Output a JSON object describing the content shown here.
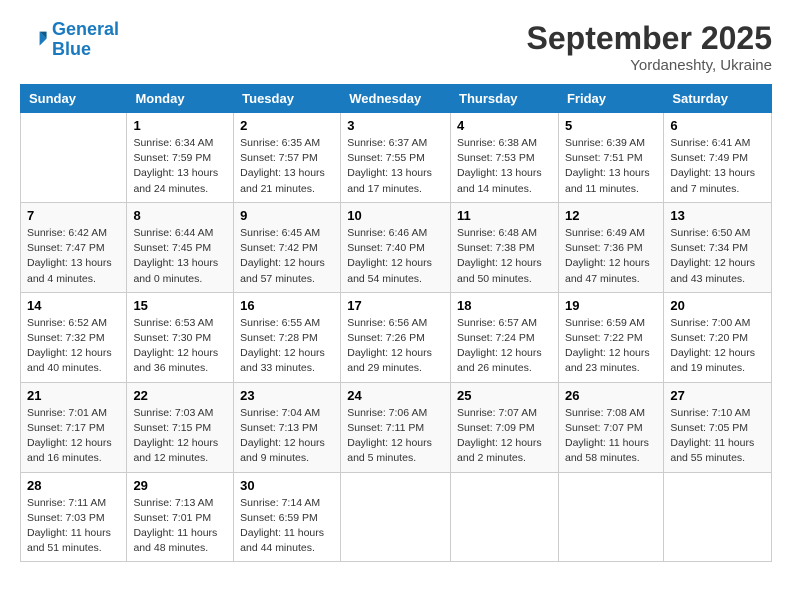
{
  "header": {
    "logo_line1": "General",
    "logo_line2": "Blue",
    "month": "September 2025",
    "location": "Yordaneshty, Ukraine"
  },
  "weekdays": [
    "Sunday",
    "Monday",
    "Tuesday",
    "Wednesday",
    "Thursday",
    "Friday",
    "Saturday"
  ],
  "weeks": [
    [
      {
        "day": "",
        "sunrise": "",
        "sunset": "",
        "daylight": ""
      },
      {
        "day": "1",
        "sunrise": "Sunrise: 6:34 AM",
        "sunset": "Sunset: 7:59 PM",
        "daylight": "Daylight: 13 hours and 24 minutes."
      },
      {
        "day": "2",
        "sunrise": "Sunrise: 6:35 AM",
        "sunset": "Sunset: 7:57 PM",
        "daylight": "Daylight: 13 hours and 21 minutes."
      },
      {
        "day": "3",
        "sunrise": "Sunrise: 6:37 AM",
        "sunset": "Sunset: 7:55 PM",
        "daylight": "Daylight: 13 hours and 17 minutes."
      },
      {
        "day": "4",
        "sunrise": "Sunrise: 6:38 AM",
        "sunset": "Sunset: 7:53 PM",
        "daylight": "Daylight: 13 hours and 14 minutes."
      },
      {
        "day": "5",
        "sunrise": "Sunrise: 6:39 AM",
        "sunset": "Sunset: 7:51 PM",
        "daylight": "Daylight: 13 hours and 11 minutes."
      },
      {
        "day": "6",
        "sunrise": "Sunrise: 6:41 AM",
        "sunset": "Sunset: 7:49 PM",
        "daylight": "Daylight: 13 hours and 7 minutes."
      }
    ],
    [
      {
        "day": "7",
        "sunrise": "Sunrise: 6:42 AM",
        "sunset": "Sunset: 7:47 PM",
        "daylight": "Daylight: 13 hours and 4 minutes."
      },
      {
        "day": "8",
        "sunrise": "Sunrise: 6:44 AM",
        "sunset": "Sunset: 7:45 PM",
        "daylight": "Daylight: 13 hours and 0 minutes."
      },
      {
        "day": "9",
        "sunrise": "Sunrise: 6:45 AM",
        "sunset": "Sunset: 7:42 PM",
        "daylight": "Daylight: 12 hours and 57 minutes."
      },
      {
        "day": "10",
        "sunrise": "Sunrise: 6:46 AM",
        "sunset": "Sunset: 7:40 PM",
        "daylight": "Daylight: 12 hours and 54 minutes."
      },
      {
        "day": "11",
        "sunrise": "Sunrise: 6:48 AM",
        "sunset": "Sunset: 7:38 PM",
        "daylight": "Daylight: 12 hours and 50 minutes."
      },
      {
        "day": "12",
        "sunrise": "Sunrise: 6:49 AM",
        "sunset": "Sunset: 7:36 PM",
        "daylight": "Daylight: 12 hours and 47 minutes."
      },
      {
        "day": "13",
        "sunrise": "Sunrise: 6:50 AM",
        "sunset": "Sunset: 7:34 PM",
        "daylight": "Daylight: 12 hours and 43 minutes."
      }
    ],
    [
      {
        "day": "14",
        "sunrise": "Sunrise: 6:52 AM",
        "sunset": "Sunset: 7:32 PM",
        "daylight": "Daylight: 12 hours and 40 minutes."
      },
      {
        "day": "15",
        "sunrise": "Sunrise: 6:53 AM",
        "sunset": "Sunset: 7:30 PM",
        "daylight": "Daylight: 12 hours and 36 minutes."
      },
      {
        "day": "16",
        "sunrise": "Sunrise: 6:55 AM",
        "sunset": "Sunset: 7:28 PM",
        "daylight": "Daylight: 12 hours and 33 minutes."
      },
      {
        "day": "17",
        "sunrise": "Sunrise: 6:56 AM",
        "sunset": "Sunset: 7:26 PM",
        "daylight": "Daylight: 12 hours and 29 minutes."
      },
      {
        "day": "18",
        "sunrise": "Sunrise: 6:57 AM",
        "sunset": "Sunset: 7:24 PM",
        "daylight": "Daylight: 12 hours and 26 minutes."
      },
      {
        "day": "19",
        "sunrise": "Sunrise: 6:59 AM",
        "sunset": "Sunset: 7:22 PM",
        "daylight": "Daylight: 12 hours and 23 minutes."
      },
      {
        "day": "20",
        "sunrise": "Sunrise: 7:00 AM",
        "sunset": "Sunset: 7:20 PM",
        "daylight": "Daylight: 12 hours and 19 minutes."
      }
    ],
    [
      {
        "day": "21",
        "sunrise": "Sunrise: 7:01 AM",
        "sunset": "Sunset: 7:17 PM",
        "daylight": "Daylight: 12 hours and 16 minutes."
      },
      {
        "day": "22",
        "sunrise": "Sunrise: 7:03 AM",
        "sunset": "Sunset: 7:15 PM",
        "daylight": "Daylight: 12 hours and 12 minutes."
      },
      {
        "day": "23",
        "sunrise": "Sunrise: 7:04 AM",
        "sunset": "Sunset: 7:13 PM",
        "daylight": "Daylight: 12 hours and 9 minutes."
      },
      {
        "day": "24",
        "sunrise": "Sunrise: 7:06 AM",
        "sunset": "Sunset: 7:11 PM",
        "daylight": "Daylight: 12 hours and 5 minutes."
      },
      {
        "day": "25",
        "sunrise": "Sunrise: 7:07 AM",
        "sunset": "Sunset: 7:09 PM",
        "daylight": "Daylight: 12 hours and 2 minutes."
      },
      {
        "day": "26",
        "sunrise": "Sunrise: 7:08 AM",
        "sunset": "Sunset: 7:07 PM",
        "daylight": "Daylight: 11 hours and 58 minutes."
      },
      {
        "day": "27",
        "sunrise": "Sunrise: 7:10 AM",
        "sunset": "Sunset: 7:05 PM",
        "daylight": "Daylight: 11 hours and 55 minutes."
      }
    ],
    [
      {
        "day": "28",
        "sunrise": "Sunrise: 7:11 AM",
        "sunset": "Sunset: 7:03 PM",
        "daylight": "Daylight: 11 hours and 51 minutes."
      },
      {
        "day": "29",
        "sunrise": "Sunrise: 7:13 AM",
        "sunset": "Sunset: 7:01 PM",
        "daylight": "Daylight: 11 hours and 48 minutes."
      },
      {
        "day": "30",
        "sunrise": "Sunrise: 7:14 AM",
        "sunset": "Sunset: 6:59 PM",
        "daylight": "Daylight: 11 hours and 44 minutes."
      },
      {
        "day": "",
        "sunrise": "",
        "sunset": "",
        "daylight": ""
      },
      {
        "day": "",
        "sunrise": "",
        "sunset": "",
        "daylight": ""
      },
      {
        "day": "",
        "sunrise": "",
        "sunset": "",
        "daylight": ""
      },
      {
        "day": "",
        "sunrise": "",
        "sunset": "",
        "daylight": ""
      }
    ]
  ]
}
